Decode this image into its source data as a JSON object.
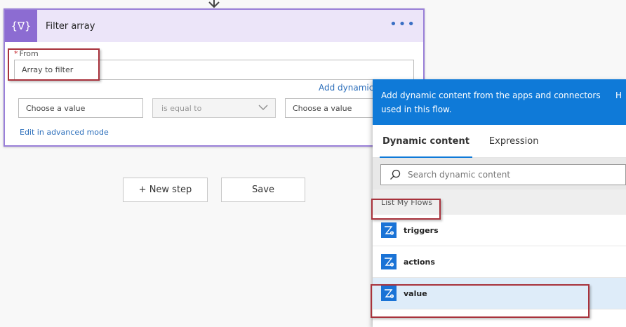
{
  "card": {
    "title": "Filter array",
    "icon_text": "{∇}",
    "more_label": "•••",
    "from_required": "*",
    "from_label": "From",
    "from_value": "Array to filter",
    "add_dynamic_label": "Add dynamic",
    "left_value_placeholder": "Choose a value",
    "operator": "is equal to",
    "right_value_placeholder": "Choose a value",
    "advanced_link": "Edit in advanced mode"
  },
  "actions": {
    "new_step": "+ New step",
    "save": "Save"
  },
  "panel": {
    "header_text": "Add dynamic content from the apps and connectors used in this flow.",
    "header_edge": "H",
    "tabs": [
      {
        "label": "Dynamic content",
        "active": true
      },
      {
        "label": "Expression",
        "active": false
      }
    ],
    "search_placeholder": "Search dynamic content",
    "group_label": "List My Flows",
    "items": [
      {
        "label": "triggers",
        "icon": "flow-token-icon"
      },
      {
        "label": "actions",
        "icon": "flow-token-icon"
      },
      {
        "label": "value",
        "icon": "flow-token-icon"
      }
    ]
  },
  "colors": {
    "accent_purple": "#8c6cd2",
    "header_lavender": "#ece5f9",
    "panel_blue": "#0f7ad8",
    "highlight_red": "#a8323c",
    "selected_row": "#deecf9"
  }
}
